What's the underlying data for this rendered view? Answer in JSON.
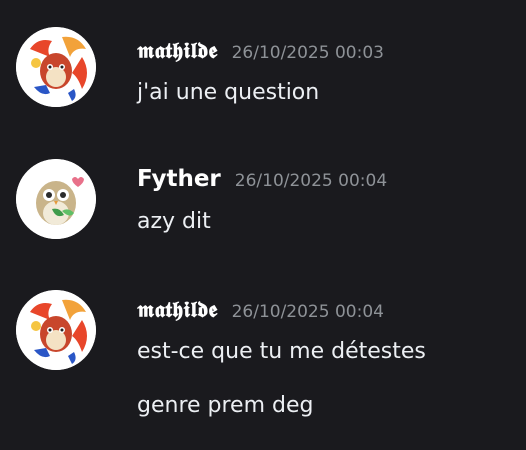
{
  "messages": [
    {
      "author": "𝖒𝖆𝖙𝖍𝖎𝖑𝖉𝖊",
      "timestamp": "26/10/2025 00:03",
      "avatar_icon": "fire-pokemon-avatar-icon",
      "lines": [
        "j'ai une question"
      ]
    },
    {
      "author": "Fyther",
      "timestamp": "26/10/2025 00:04",
      "avatar_icon": "owl-pokemon-avatar-icon",
      "lines": [
        "azy dit"
      ]
    },
    {
      "author": "𝖒𝖆𝖙𝖍𝖎𝖑𝖉𝖊",
      "timestamp": "26/10/2025 00:04",
      "avatar_icon": "fire-pokemon-avatar-icon",
      "lines": [
        "est-ce que tu me détestes",
        "genre prem deg"
      ]
    }
  ],
  "colors": {
    "background": "#1a1a1e",
    "text": "#eceff3",
    "timestamp": "#8e9297"
  }
}
